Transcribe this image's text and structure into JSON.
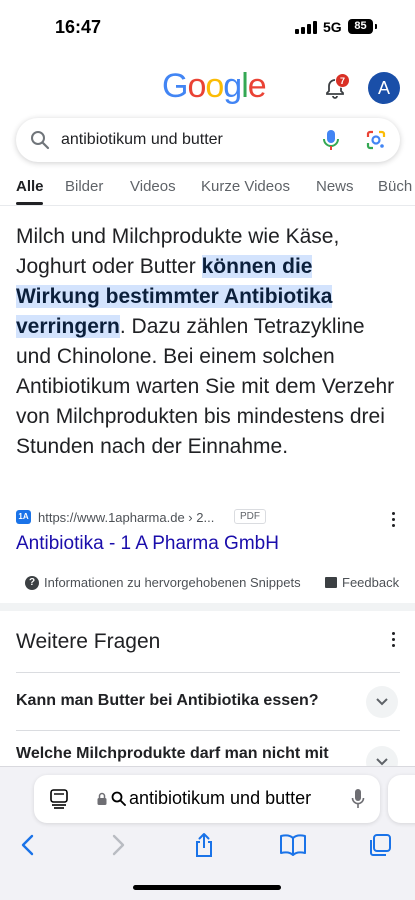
{
  "status_bar": {
    "time": "16:47",
    "network": "5G",
    "battery": "85"
  },
  "header": {
    "logo_letters": [
      "G",
      "o",
      "o",
      "g",
      "l",
      "e"
    ],
    "logo_colors": [
      "#4285F4",
      "#EA4335",
      "#FBBC05",
      "#4285F4",
      "#34A853",
      "#EA4335"
    ],
    "notification_count": "7",
    "avatar_letter": "A"
  },
  "search": {
    "query": "antibiotikum und butter"
  },
  "tabs": [
    {
      "label": "Alle",
      "active": true
    },
    {
      "label": "Bilder"
    },
    {
      "label": "Videos"
    },
    {
      "label": "Kurze Videos"
    },
    {
      "label": "News"
    },
    {
      "label": "Büch"
    }
  ],
  "snippet": {
    "text_before": "Milch und Milchprodukte wie Käse, Joghurt oder Butter ",
    "highlight": "können die Wirkung bestimmter Antibiotika verringern",
    "text_after": ". Dazu zählen Tetrazykline und Chinolone. Bei einem solchen Antibiotikum warten Sie mit dem Verzehr von Milchprodukten bis mindestens drei Stunden nach der Einnahme.",
    "source_favicon": "1A",
    "source_url": "https://www.1apharma.de › 2...",
    "source_tag": "PDF",
    "result_title": "Antibiotika - 1 A Pharma GmbH",
    "info_label": "Informationen zu hervorgehobenen Snippets",
    "feedback_label": "Feedback"
  },
  "related_questions": {
    "title": "Weitere Fragen",
    "items": [
      "Kann man Butter bei Antibiotika essen?",
      "Welche Milchprodukte darf man nicht mit"
    ]
  },
  "browser": {
    "address_text": "antibiotikum und butter",
    "toolbar": [
      "back-icon",
      "forward-icon",
      "share-icon",
      "bookmarks-icon",
      "tabs-icon"
    ]
  },
  "colors": {
    "link": "#1a0dab",
    "highlight": "#d3e3fd",
    "accent_blue": "#1a73e8"
  }
}
